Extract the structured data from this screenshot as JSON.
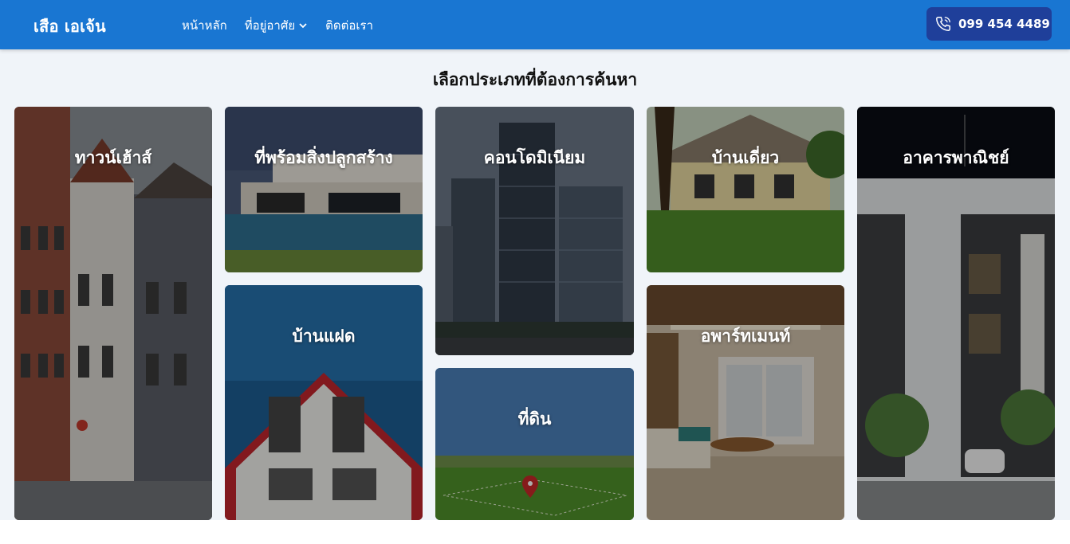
{
  "header": {
    "brand": "เสือ เอเจ้น",
    "nav": [
      {
        "label": "หน้าหลัก"
      },
      {
        "label": "ที่อยู่อาศัย",
        "has_dropdown": true
      },
      {
        "label": "ติดต่อเรา"
      }
    ],
    "phone": "099 454 4489"
  },
  "main": {
    "title": "เลือกประเภทที่ต้องการค้นหา",
    "categories": [
      {
        "label": "ทาวน์เฮ้าส์"
      },
      {
        "label": "ที่พร้อมสิ่งปลูกสร้าง"
      },
      {
        "label": "บ้านแฝด"
      },
      {
        "label": "คอนโดมิเนียม"
      },
      {
        "label": "ที่ดิน"
      },
      {
        "label": "บ้านเดี่ยว"
      },
      {
        "label": "อพาร์ทเมนท์"
      },
      {
        "label": "อาคารพาณิชย์"
      }
    ]
  },
  "colors": {
    "header_bg": "#1976d2",
    "phone_bg": "#1f3f9a",
    "page_bg": "#f0f4f9"
  }
}
